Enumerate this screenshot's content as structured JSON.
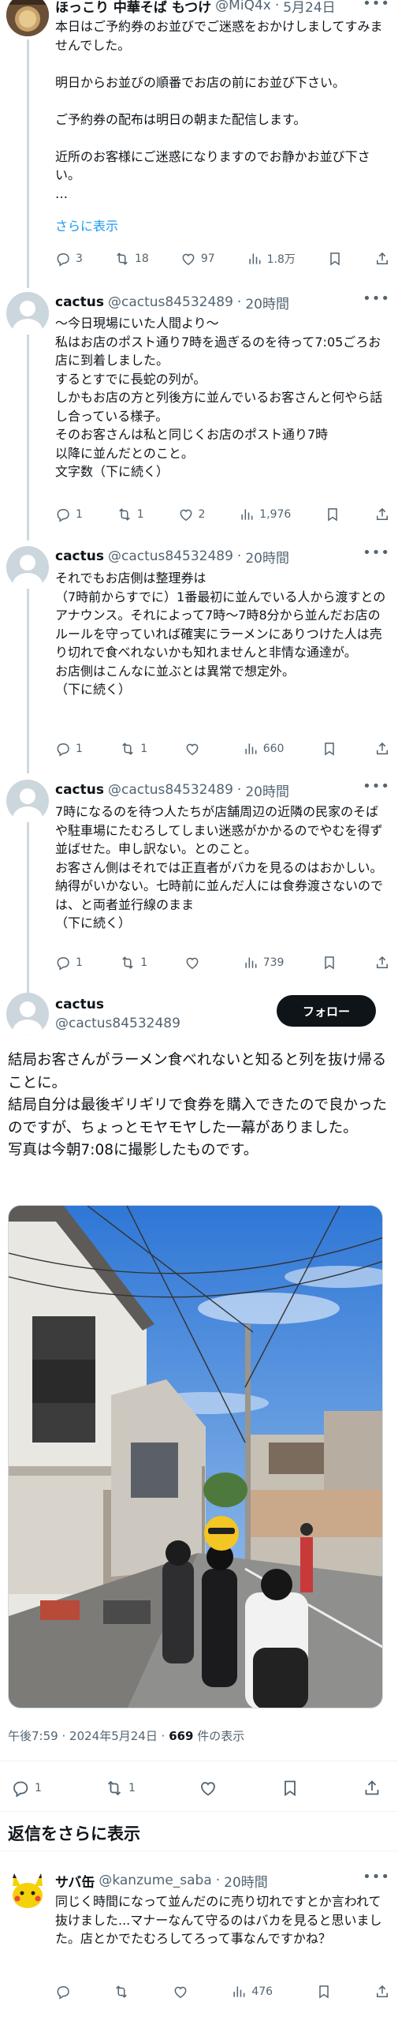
{
  "tweets": [
    {
      "name": "ほっこり 中華そば もつけ",
      "handle": "@MiQ4x",
      "sep": "·",
      "date": "5月24日",
      "text": "本日はご予約券のお並びでご迷惑をおかけしましてすみませんでした。\n\n明日からお並びの順番でお店の前にお並び下さい。\n\nご予約券の配布は明日の朝また配信します。\n\n近所のお客様にご迷惑になりますのでお静かお並び下さい。\n…",
      "show_more": "さらに表示",
      "replies": "3",
      "retweets": "18",
      "likes": "97",
      "views": "1.8万"
    },
    {
      "name": "cactus",
      "handle": "@cactus84532489",
      "sep": "·",
      "date": "20時間",
      "text": "〜今日現場にいた人間より〜\n私はお店のポスト通り7時を過ぎるのを待って7:05ごろお店に到着しました。\nするとすでに長蛇の列が。\nしかもお店の方と列後方に並んでいるお客さんと何やら話し合っている様子。\nそのお客さんは私と同じくお店のポスト通り7時\n以降に並んだとのこと。\n文字数（下に続く）",
      "replies": "1",
      "retweets": "1",
      "likes": "2",
      "views": "1,976"
    },
    {
      "name": "cactus",
      "handle": "@cactus84532489",
      "sep": "·",
      "date": "20時間",
      "text": "それでもお店側は整理券は\n（7時前からすでに）1番最初に並んでいる人から渡すとのアナウンス。それによって7時〜7時8分から並んだお店のルールを守っていれば確実にラーメンにありつけた人は売り切れで食べれないかも知れませんと非情な通達が。\nお店側はこんなに並ぶとは異常で想定外。\n（下に続く）",
      "replies": "1",
      "retweets": "1",
      "likes": "",
      "views": "660"
    },
    {
      "name": "cactus",
      "handle": "@cactus84532489",
      "sep": "·",
      "date": "20時間",
      "text": "7時になるのを待つ人たちが店舗周辺の近隣の民家のそばや駐車場にたむろしてしまい迷惑がかかるのでやむを得ず並ばせた。申し訳ない。とのこと。\nお客さん側はそれでは正直者がバカを見るのはおかしい。納得がいかない。七時前に並んだ人には食券渡さないのでは、と両者並行線のまま\n（下に続く）",
      "replies": "1",
      "retweets": "1",
      "likes": "",
      "views": "739"
    }
  ],
  "main": {
    "name": "cactus",
    "handle": "@cactus84532489",
    "follow_label": "フォロー",
    "text": "結局お客さんがラーメン食べれないと知ると列を抜け帰ることに。\n結局自分は最後ギリギリで食券を購入できたので良かったのですが、ちょっとモヤモヤした一幕がありました。\n写真は今朝7:08に撮影したものです。",
    "time": "午後7:59",
    "sep": "·",
    "date": "2024年5月24日",
    "views_count": "669",
    "views_label": "件の表示",
    "replies": "1",
    "retweets": "1"
  },
  "more_replies_label": "返信をさらに表示",
  "reply": {
    "name": "サバ缶",
    "handle": "@kanzume_saba",
    "sep": "·",
    "date": "20時間",
    "text": "同じく時間になって並んだのに売り切れですとか言われて抜けました...マナーなんて守るのはバカを見ると思いました。店とかでたむろしてろって事なんですかね？",
    "views": "476"
  },
  "colors": {
    "accent": "#1d9bf0",
    "text": "#0f1419",
    "muted": "#536471",
    "follow_bg": "#0f1419"
  },
  "icons": [
    "reply-icon",
    "retweet-icon",
    "like-icon",
    "views-icon",
    "bookmark-icon",
    "share-icon",
    "more-icon"
  ]
}
